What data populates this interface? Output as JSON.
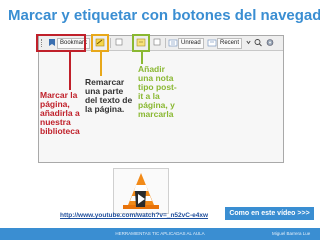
{
  "slide": {
    "title": "Marcar y etiquetar con botones del navegador"
  },
  "toolbar": {
    "bookmark_label": "Bookmark",
    "unread_label": "Unread",
    "recent_label": "Recent"
  },
  "callouts": {
    "bookmark": {
      "text": "Marcar la\npágina,\nañadirla a\nnuestra\nbiblioteca",
      "color": "#c0202a"
    },
    "highlight": {
      "text": "Remarcar\nuna parte\ndel texto de\nla página.",
      "color": "#e8a81a"
    },
    "note": {
      "text": "Añadir\nuna nota\ntipo post-\nit a la\npágina, y\nmarcarla",
      "color": "#8ab832"
    }
  },
  "video": {
    "link_text": "http://www.youtube.com/watch?v=_n52vC-e4xw",
    "cta_text": "Como en este vídeo >>>"
  },
  "footer": {
    "center_text": "HERRAMIENTAS TIC APLICADAS AL AULA",
    "author": "Miguel Barrera Lue"
  },
  "colors": {
    "accent": "#3a8ed2"
  }
}
